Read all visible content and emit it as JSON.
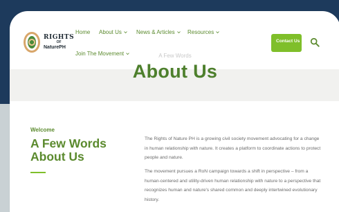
{
  "brand": {
    "line1": "RIGHTS",
    "line2": "OF",
    "line3": "NaturePH"
  },
  "nav": {
    "items": [
      {
        "label": "Home",
        "has_dropdown": false
      },
      {
        "label": "About Us",
        "has_dropdown": true
      },
      {
        "label": "News & Articles",
        "has_dropdown": true
      },
      {
        "label": "Resources",
        "has_dropdown": true
      },
      {
        "label": "Join The Movement",
        "has_dropdown": true
      }
    ],
    "contact_label": "Contact Us",
    "search_icon": "search-icon"
  },
  "hero": {
    "subtitle": "A Few Words",
    "title": "About Us"
  },
  "content": {
    "kicker": "Welcome",
    "heading": "A Few Words About Us",
    "paragraphs": [
      "The Rights of Nature PH is a growing civil society movement advocating for a change in human relationship with nature. It creates a platform to coordinate actions to protect people and nature.",
      "The movement pursues a RoN campaign towards a shift in perspective – from a human-centered and utility-driven human relationship with nature to a perspective that recognizes human and nature's shared common and deeply intertwined evolutionary history."
    ]
  },
  "colors": {
    "accent_green": "#5b8a2e",
    "button_green": "#7fbf2a",
    "navy_background": "#1d3a5c",
    "hero_band": "#f1f1ef"
  }
}
